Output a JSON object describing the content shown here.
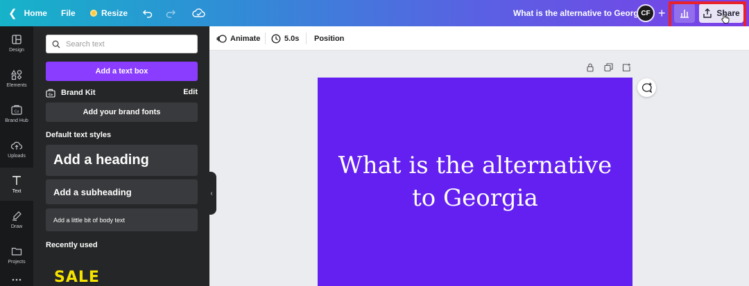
{
  "topbar": {
    "home_label": "Home",
    "file_label": "File",
    "resize_label": "Resize",
    "doc_title": "What is the alternative to Georgia",
    "avatar_initials": "CF",
    "share_label": "Share"
  },
  "rail": {
    "items": [
      {
        "label": "Design",
        "icon": "layout-icon"
      },
      {
        "label": "Elements",
        "icon": "shapes-icon"
      },
      {
        "label": "Brand Hub",
        "icon": "brand-hub-icon"
      },
      {
        "label": "Uploads",
        "icon": "cloud-upload-icon"
      },
      {
        "label": "Text",
        "icon": "text-t-icon",
        "active": true
      },
      {
        "label": "Draw",
        "icon": "pen-icon"
      },
      {
        "label": "Projects",
        "icon": "folder-icon"
      }
    ]
  },
  "panel": {
    "search_placeholder": "Search text",
    "add_textbox_label": "Add a text box",
    "brand_kit_label": "Brand Kit",
    "brand_kit_edit": "Edit",
    "brand_fonts_label": "Add your brand fonts",
    "default_styles_title": "Default text styles",
    "heading_label": "Add a heading",
    "subheading_label": "Add a subheading",
    "body_label": "Add a little bit of body text",
    "recently_used_title": "Recently used",
    "recent_item": "SALE"
  },
  "toolbar": {
    "animate_label": "Animate",
    "duration_label": "5.0s",
    "position_label": "Position"
  },
  "canvas": {
    "design_text": "What is the alternative to Georgia",
    "design_bg": "#6420f0"
  },
  "colors": {
    "accent": "#8b3dff",
    "highlight": "#e8212b"
  }
}
